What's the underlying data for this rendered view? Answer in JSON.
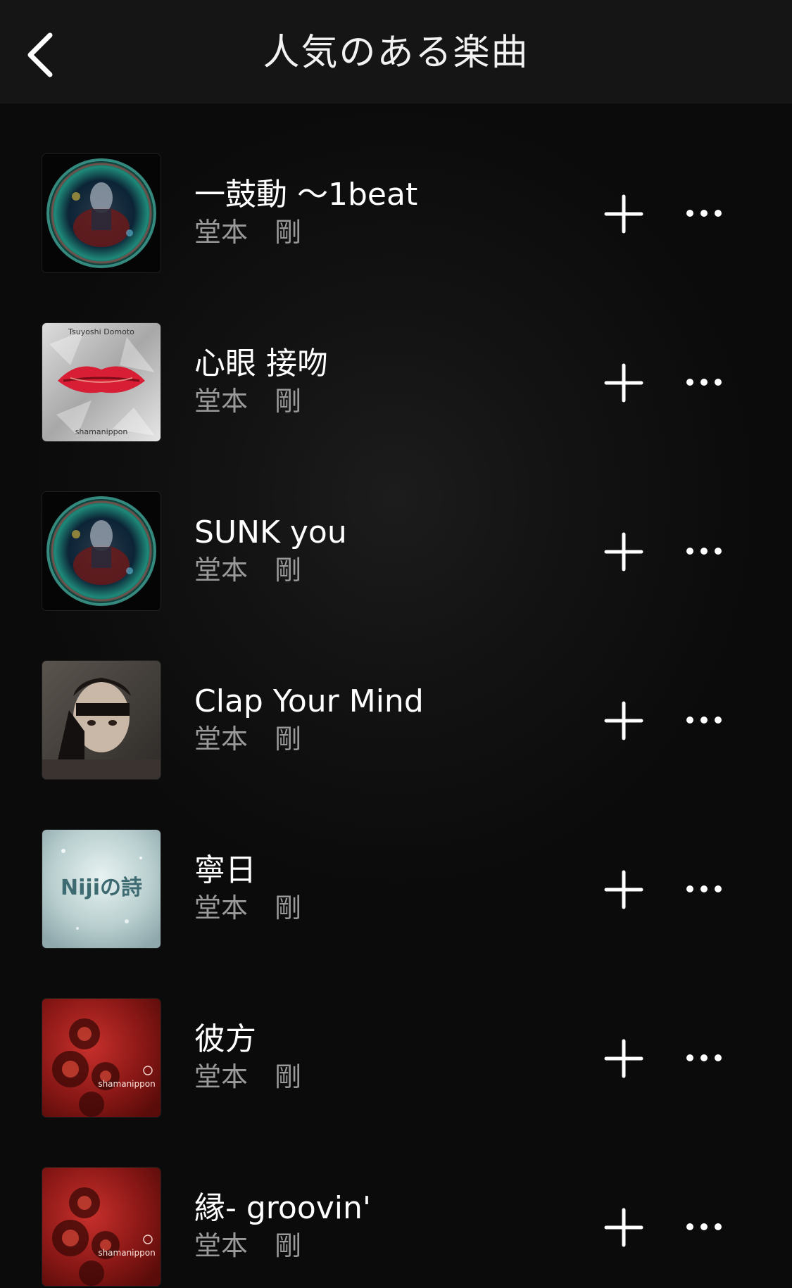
{
  "header": {
    "title": "人気のある楽曲",
    "back_icon": "chevron-left-icon"
  },
  "tracks": [
    {
      "title": "一鼓動 〜1beat",
      "artist": "堂本　剛",
      "art": "orb",
      "add_icon": "plus-icon",
      "more_icon": "more-horizontal-icon"
    },
    {
      "title": "心眼 接吻",
      "artist": "堂本　剛",
      "art": "lips",
      "art_text_top": "Tsuyoshi Domoto",
      "art_text_bottom": "shamanippon",
      "add_icon": "plus-icon",
      "more_icon": "more-horizontal-icon"
    },
    {
      "title": "SUNK you",
      "artist": "堂本　剛",
      "art": "orb",
      "add_icon": "plus-icon",
      "more_icon": "more-horizontal-icon"
    },
    {
      "title": "Clap Your Mind",
      "artist": "堂本　剛",
      "art": "portrait",
      "add_icon": "plus-icon",
      "more_icon": "more-horizontal-icon"
    },
    {
      "title": "寧日",
      "artist": "堂本　剛",
      "art": "niji",
      "art_text": "Nijiの詩",
      "add_icon": "plus-icon",
      "more_icon": "more-horizontal-icon"
    },
    {
      "title": "彼方",
      "artist": "堂本　剛",
      "art": "redflower",
      "art_text": "shamanippon",
      "add_icon": "plus-icon",
      "more_icon": "more-horizontal-icon"
    },
    {
      "title": "縁- groovin'",
      "artist": "堂本　剛",
      "art": "redflower",
      "art_text": "shamanippon",
      "add_icon": "plus-icon",
      "more_icon": "more-horizontal-icon"
    }
  ],
  "colors": {
    "header_bg": "#151515",
    "background": "#0b0b0b",
    "title_text": "#ffffff",
    "artist_text": "#9a9a9a"
  }
}
